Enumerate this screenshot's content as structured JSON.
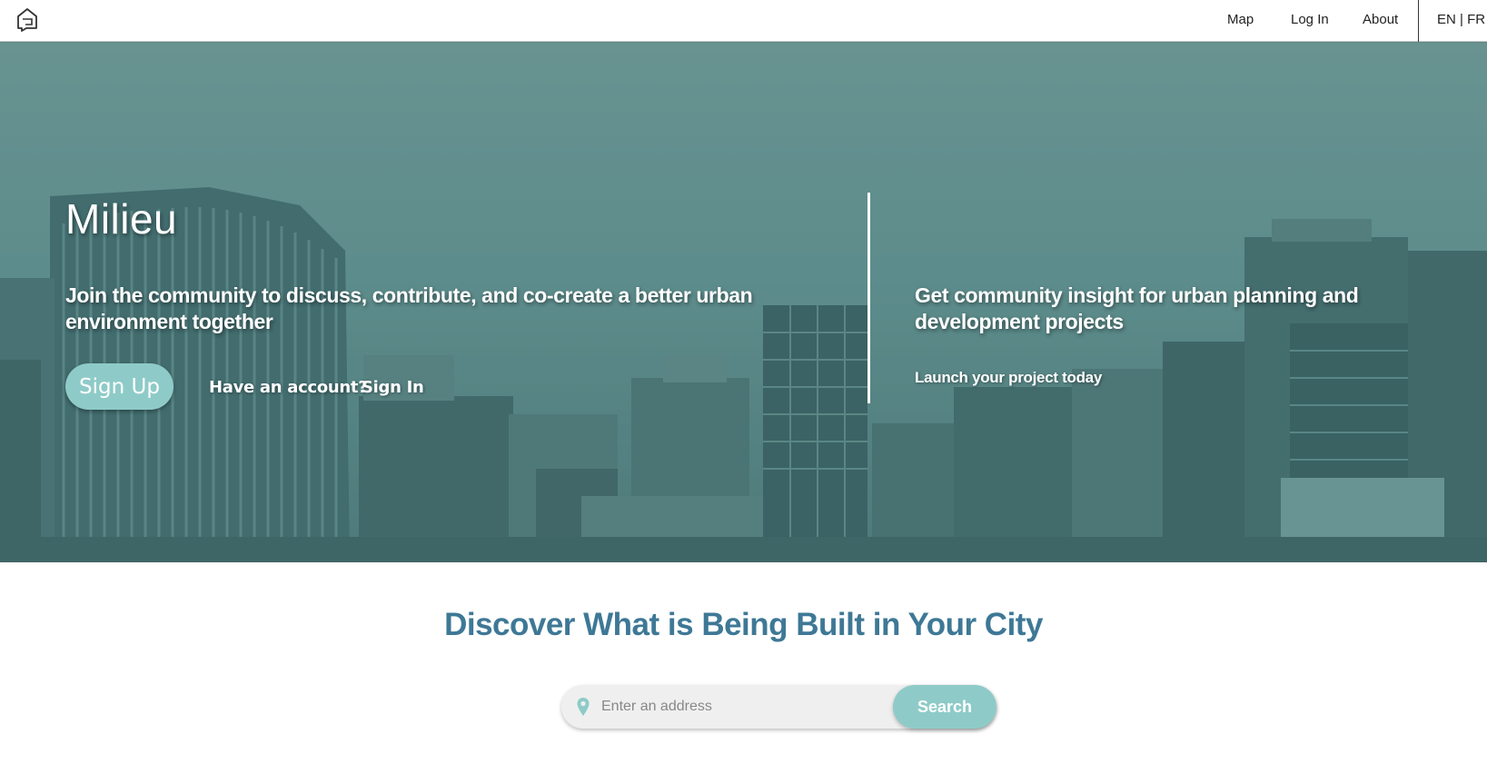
{
  "nav": {
    "logo_icon": "house-chat-icon",
    "map": "Map",
    "login": "Log In",
    "about": "About",
    "lang": "EN | FR"
  },
  "hero": {
    "title": "Milieu",
    "left_text": "Join the community to discuss, contribute, and co-create a better urban environment together",
    "signup_label": "Sign Up",
    "have_account": "Have an account?",
    "signin_label": "Sign In",
    "right_text": "Get community insight for urban planning and development projects",
    "launch_label": "Launch your project today"
  },
  "discover": {
    "title": "Discover What is Being Built in Your City",
    "search_placeholder": "Enter an address",
    "search_value": "",
    "search_button": "Search",
    "pin_icon": "map-pin-icon"
  },
  "colors": {
    "accent": "#8ecbc8",
    "heading": "#3e7896",
    "hero_tint": "#5f8d8c"
  }
}
